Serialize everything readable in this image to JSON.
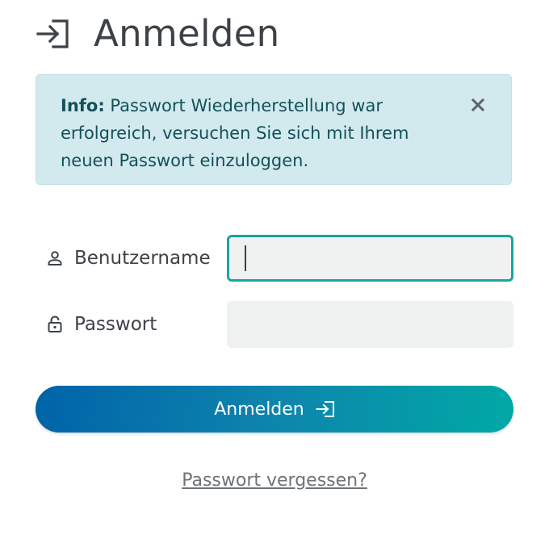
{
  "header": {
    "title": "Anmelden",
    "icon": "login-icon"
  },
  "alert": {
    "label": "Info:",
    "message": " Passwort Wiederherstellung war erfolgreich, versuchen Sie sich mit Ihrem neuen Passwort einzuloggen.",
    "close_icon": "close-icon",
    "background_color": "#d2eaee",
    "text_color": "#14505a"
  },
  "form": {
    "username": {
      "label": "Benutzername",
      "icon": "user-icon",
      "value": ""
    },
    "password": {
      "label": "Passwort",
      "icon": "lock-icon",
      "value": ""
    },
    "focus_color": "#16a6a2"
  },
  "submit": {
    "label": "Anmelden",
    "icon": "login-icon",
    "gradient_start": "#0063a8",
    "gradient_end": "#00a9a5"
  },
  "forgot_link": {
    "label": "Passwort vergessen?"
  }
}
